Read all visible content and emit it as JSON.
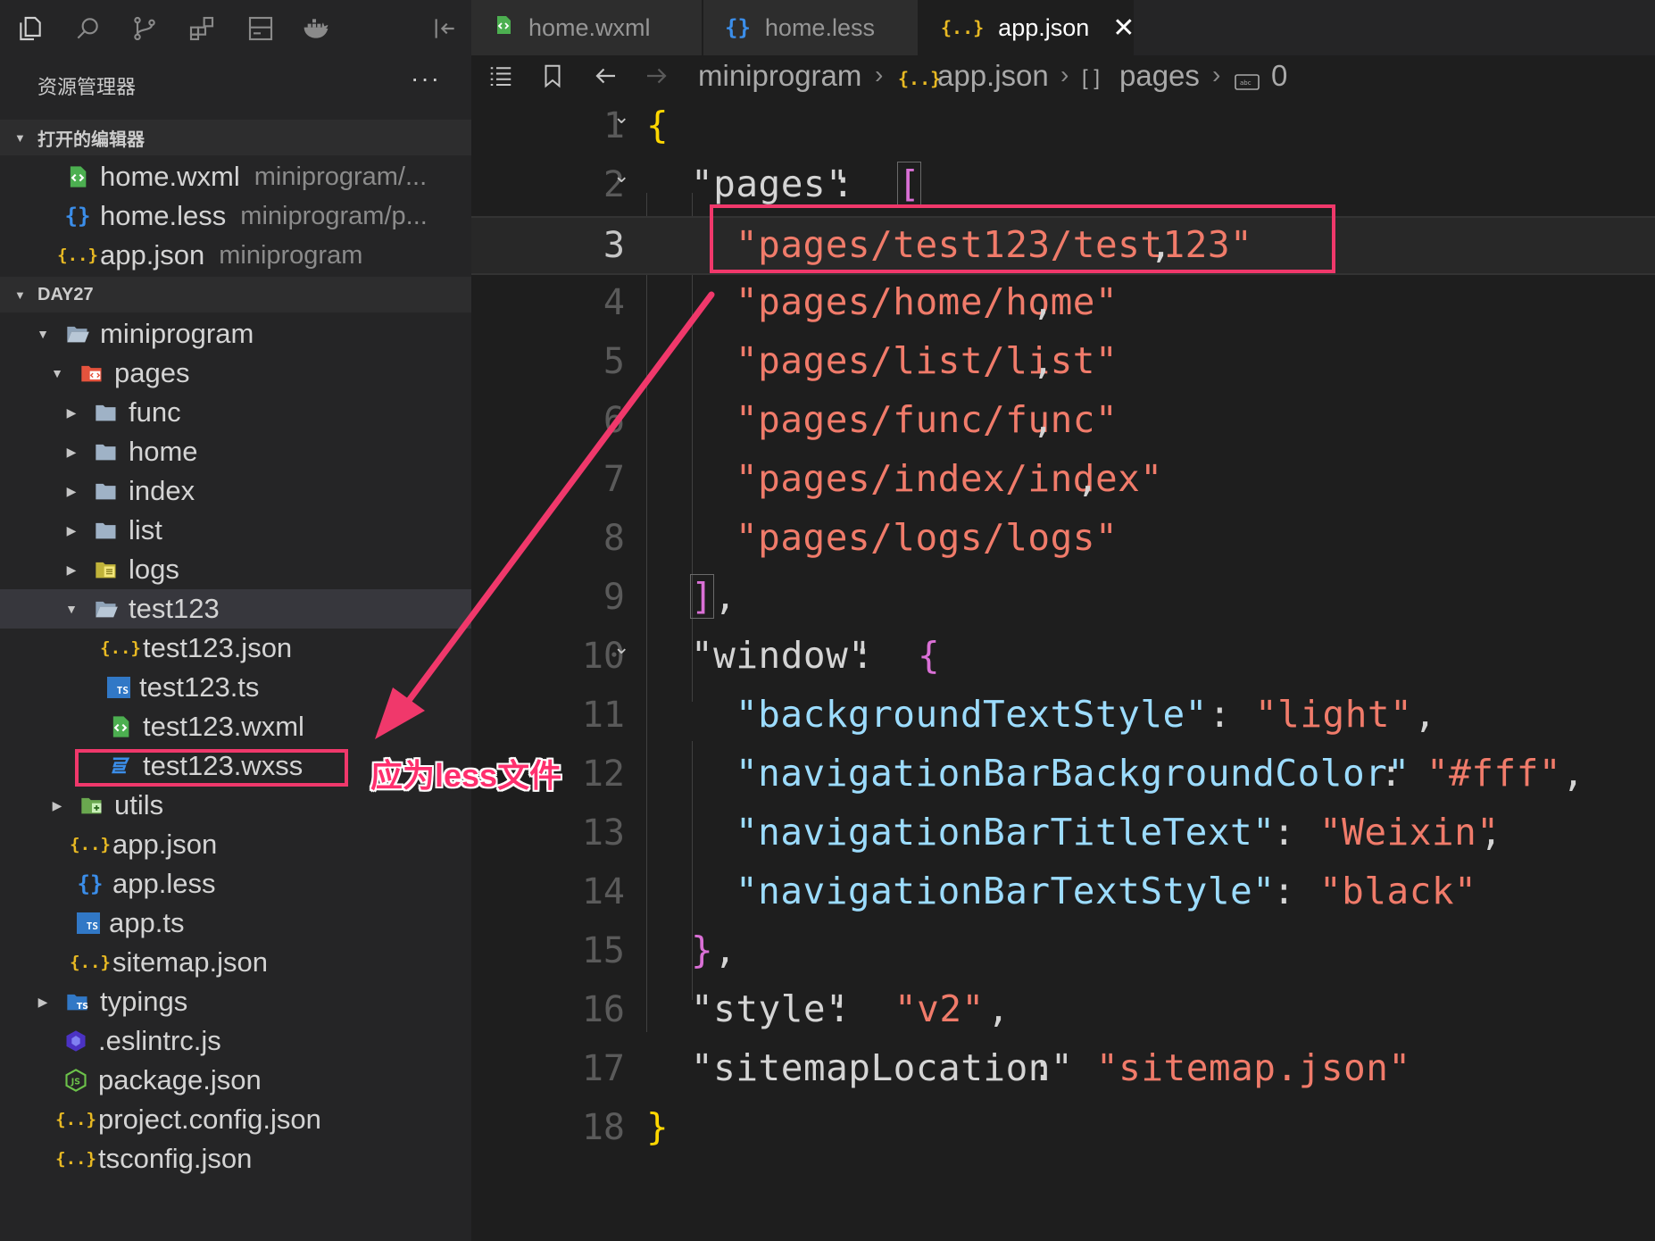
{
  "sidebar": {
    "title": "资源管理器",
    "more": "···",
    "open_editors": {
      "header": "打开的编辑器",
      "items": [
        {
          "name": "home.wxml",
          "desc": "miniprogram/..."
        },
        {
          "name": "home.less",
          "desc": "miniprogram/p..."
        },
        {
          "name": "app.json",
          "desc": "miniprogram"
        }
      ]
    },
    "workspace": {
      "header": "DAY27",
      "tree": [
        "miniprogram",
        "pages",
        "func",
        "home",
        "index",
        "list",
        "logs",
        "test123",
        "test123.json",
        "test123.ts",
        "test123.wxml",
        "test123.wxss",
        "utils",
        "app.json",
        "app.less",
        "app.ts",
        "sitemap.json",
        "typings",
        ".eslintrc.js",
        "package.json",
        "project.config.json",
        "tsconfig.json"
      ]
    }
  },
  "annotation": "应为less文件",
  "tabs": [
    {
      "label": "home.wxml",
      "icon": "wxml-icon"
    },
    {
      "label": "home.less",
      "icon": "{}"
    },
    {
      "label": "app.json",
      "icon": "{..}",
      "active": true
    }
  ],
  "breadcrumb": {
    "folder": "miniprogram",
    "file": "app.json",
    "array": "pages",
    "index": "0"
  },
  "code": {
    "lines": [
      {
        "n": "1"
      },
      {
        "n": "2"
      },
      {
        "n": "3"
      },
      {
        "n": "4"
      },
      {
        "n": "5"
      },
      {
        "n": "6"
      },
      {
        "n": "7"
      },
      {
        "n": "8"
      },
      {
        "n": "9"
      },
      {
        "n": "10"
      },
      {
        "n": "11"
      },
      {
        "n": "12"
      },
      {
        "n": "13"
      },
      {
        "n": "14"
      },
      {
        "n": "15"
      },
      {
        "n": "16"
      },
      {
        "n": "17"
      },
      {
        "n": "18"
      }
    ],
    "pages_key": "\"pages\"",
    "pages": [
      "\"pages/test123/test123\"",
      "\"pages/home/home\"",
      "\"pages/list/list\"",
      "\"pages/func/func\"",
      "\"pages/index/index\"",
      "\"pages/logs/logs\""
    ],
    "window_key": "\"window\"",
    "window": [
      {
        "k": "\"backgroundTextStyle\"",
        "v": "\"light\""
      },
      {
        "k": "\"navigationBarBackgroundColor\"",
        "v": "\"#fff\""
      },
      {
        "k": "\"navigationBarTitleText\"",
        "v": "\"Weixin\""
      },
      {
        "k": "\"navigationBarTextStyle\"",
        "v": "\"black\""
      }
    ],
    "style_key": "\"style\"",
    "style_val": "\"v2\"",
    "sitemap_key": "\"sitemapLocation\"",
    "sitemap_val": "\"sitemap.json\""
  },
  "colors": {
    "highlight": "#f0386b",
    "string": "#f07b6a",
    "key": "#9cdcfe",
    "brace": "#ffd700",
    "bracket": "#da70d6"
  }
}
